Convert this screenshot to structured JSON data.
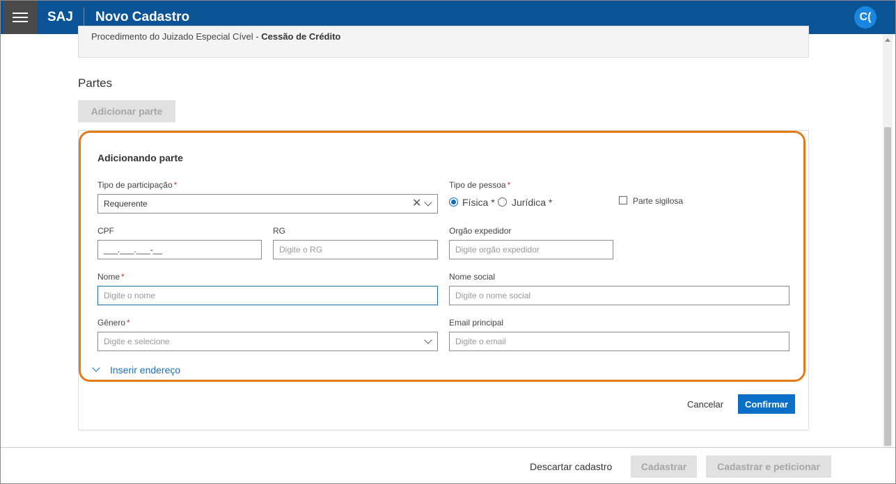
{
  "app": {
    "brand": "SAJ",
    "title": "Novo Cadastro",
    "avatar": "C("
  },
  "info": {
    "prefix": "Procedimento do Juizado Especial Cível - ",
    "bold": "Cessão de Crédito"
  },
  "partes": {
    "title": "Partes",
    "add_button": "Adicionar parte"
  },
  "form": {
    "title": "Adicionando parte",
    "tipo_participacao": {
      "label": "Tipo de participação",
      "required": "*",
      "value": "Requerente"
    },
    "tipo_pessoa": {
      "label": "Tipo de pessoa",
      "required": "*",
      "options": [
        {
          "label": "Física *",
          "selected": true
        },
        {
          "label": "Jurídica *",
          "selected": false
        }
      ]
    },
    "parte_sigilosa": {
      "label": "Parte sigilosa",
      "checked": false
    },
    "cpf": {
      "label": "CPF",
      "value": "___.___.___-__"
    },
    "rg": {
      "label": "RG",
      "placeholder": "Digite o RG"
    },
    "orgao": {
      "label": "Orgão expedidor",
      "placeholder": "Digite orgão expedidor"
    },
    "nome": {
      "label": "Nome",
      "required": "*",
      "placeholder": "Digite o nome"
    },
    "nome_social": {
      "label": "Nome social",
      "placeholder": "Digite o nome social"
    },
    "genero": {
      "label": "Gênero",
      "required": "*",
      "placeholder": "Digite e selecione"
    },
    "email": {
      "label": "Email principal",
      "placeholder": "Digite o email"
    },
    "expand_link": "Inserir endereço",
    "cancel": "Cancelar",
    "confirm": "Confirmar"
  },
  "footer": {
    "discard": "Descartar cadastro",
    "cadastrar": "Cadastrar",
    "cadastrar_peticionar": "Cadastrar e peticionar"
  },
  "colors": {
    "header": "#0a5495",
    "accent": "#0b6fc7",
    "highlight": "#e57a18"
  },
  "icons": {
    "menu": "hamburger-icon",
    "clear": "close-icon",
    "dropdown": "chevron-down-icon"
  }
}
